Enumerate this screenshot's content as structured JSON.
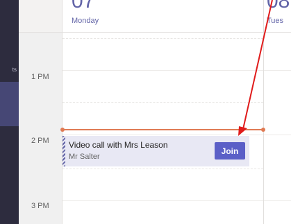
{
  "rail": {
    "items": [
      {
        "label": "ts",
        "active": false
      },
      {
        "label": "",
        "active": true
      }
    ]
  },
  "time_labels": [
    "1 PM",
    "2 PM",
    "3 PM"
  ],
  "days": [
    {
      "number": "07",
      "name": "Monday"
    },
    {
      "number": "08",
      "name": "Tues"
    }
  ],
  "event": {
    "title": "Video call with Mrs Leason",
    "organizer": "Mr Salter",
    "join_label": "Join"
  },
  "colors": {
    "accent": "#6264a7",
    "join_button": "#5b5fc7",
    "now_line": "#e07b54",
    "annotation_arrow": "#e01b1b"
  }
}
